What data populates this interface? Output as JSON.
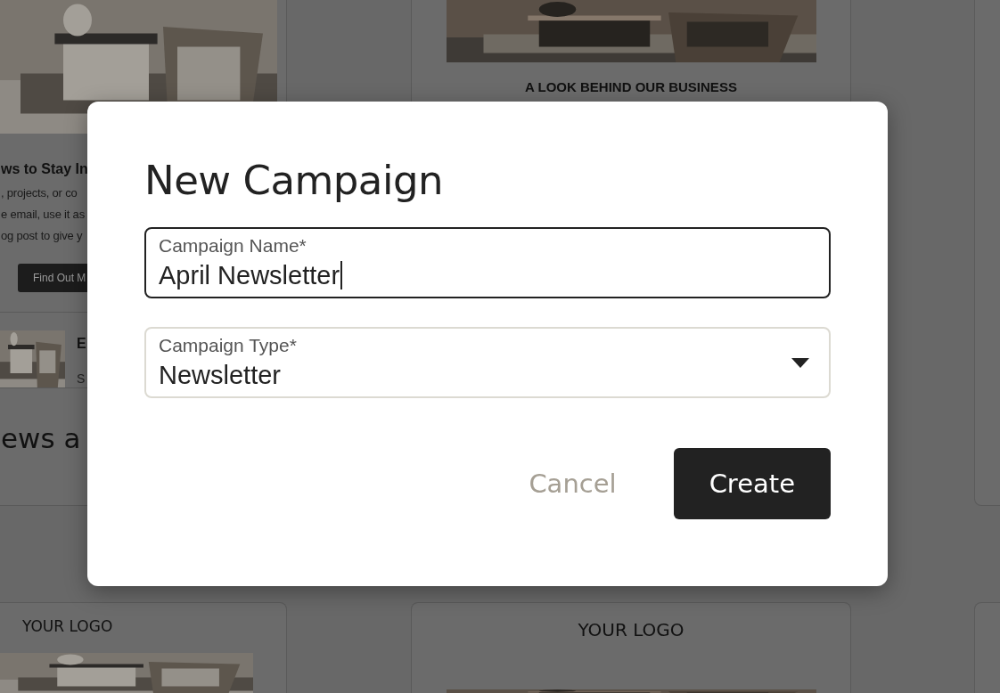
{
  "background": {
    "top_templates": [
      {
        "kind": "article",
        "heading": "ws to Stay In",
        "body_lines": [
          ", projects, or co",
          "e email, use it as",
          "og post to give y"
        ],
        "button": "Find Out M",
        "item_title": "E",
        "item_text": "S",
        "section_heading": "ews a"
      },
      {
        "kind": "feature",
        "title": "A LOOK BEHIND OUR BUSINESS"
      },
      {
        "kind": "edge"
      }
    ],
    "bottom_templates": [
      {
        "kind": "left",
        "logo": "YOUR LOGO"
      },
      {
        "kind": "center",
        "logo": "YOUR LOGO"
      },
      {
        "kind": "edge"
      }
    ]
  },
  "dialog": {
    "title": "New Campaign",
    "fields": [
      {
        "kind": "text",
        "label": "Campaign Name*",
        "value": "April Newsletter",
        "focused": true
      },
      {
        "kind": "select",
        "label": "Campaign Type*",
        "value": "Newsletter",
        "focused": false
      }
    ],
    "buttons": [
      {
        "label": "Cancel",
        "kind": "secondary"
      },
      {
        "label": "Create",
        "kind": "primary"
      }
    ]
  }
}
